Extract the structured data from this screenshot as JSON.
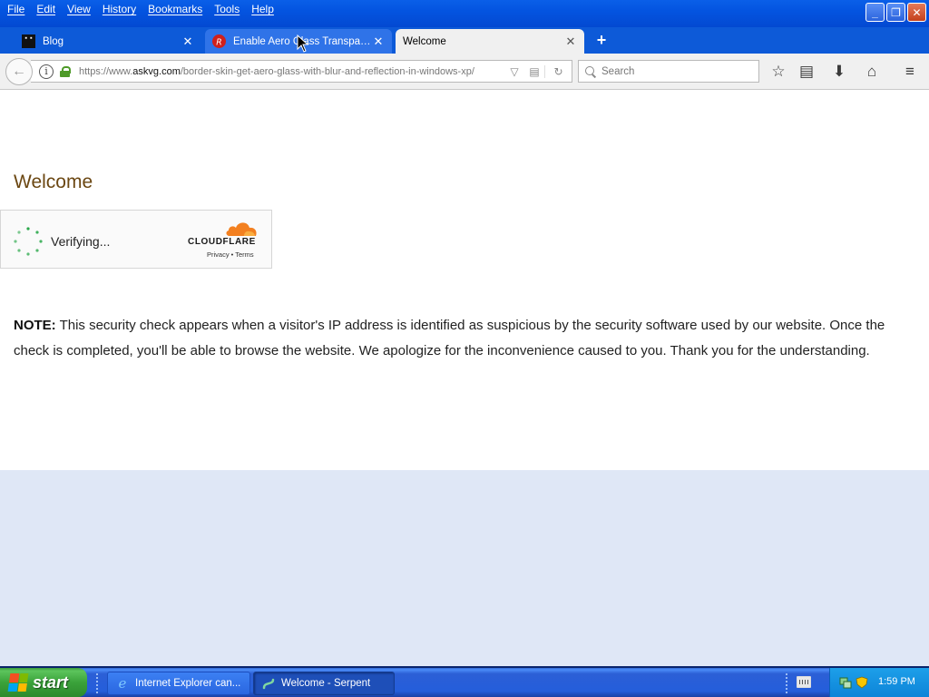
{
  "menu": [
    "File",
    "Edit",
    "View",
    "History",
    "Bookmarks",
    "Tools",
    "Help"
  ],
  "tabs": [
    {
      "title": "Blog",
      "state": "inactive"
    },
    {
      "title": "Enable Aero Glass Transpare...",
      "state": "hover"
    },
    {
      "title": "Welcome",
      "state": "active"
    }
  ],
  "navbar": {
    "url_prefix": "https://www.",
    "url_domain": "askvg.com",
    "url_path": "/border-skin-get-aero-glass-with-blur-and-reflection-in-windows-xp/",
    "search_placeholder": "Search"
  },
  "page": {
    "title": "Welcome",
    "captcha": {
      "status": "Verifying...",
      "brand": "CLOUDFLARE",
      "links": "Privacy  •  Terms"
    },
    "note_label": "NOTE:",
    "note_text": " This security check appears when a visitor's IP address is identified as suspicious by the security software used by our website. Once the check is completed, you'll be able to browse the website. We apologize for the inconvenience caused to you. Thank you for the understanding."
  },
  "taskbar": {
    "start_label": "start",
    "tasks": [
      {
        "label": "Internet Explorer can...",
        "state": "inactive"
      },
      {
        "label": "Welcome - Serpent",
        "state": "active"
      }
    ],
    "clock": "1:59 PM"
  },
  "colors": {
    "title_brown": "#6b4712",
    "cloudflare_orange": "#f38020",
    "spinner_green": "#2aa84a",
    "xp_blue": "#0454e0"
  },
  "icons": [
    "back-arrow-icon",
    "info-icon",
    "lock-icon",
    "reader-view-icon",
    "reload-icon",
    "search-icon",
    "bookmark-star-icon",
    "bookmarks-library-icon",
    "download-icon",
    "home-icon",
    "hamburger-menu-icon"
  ]
}
